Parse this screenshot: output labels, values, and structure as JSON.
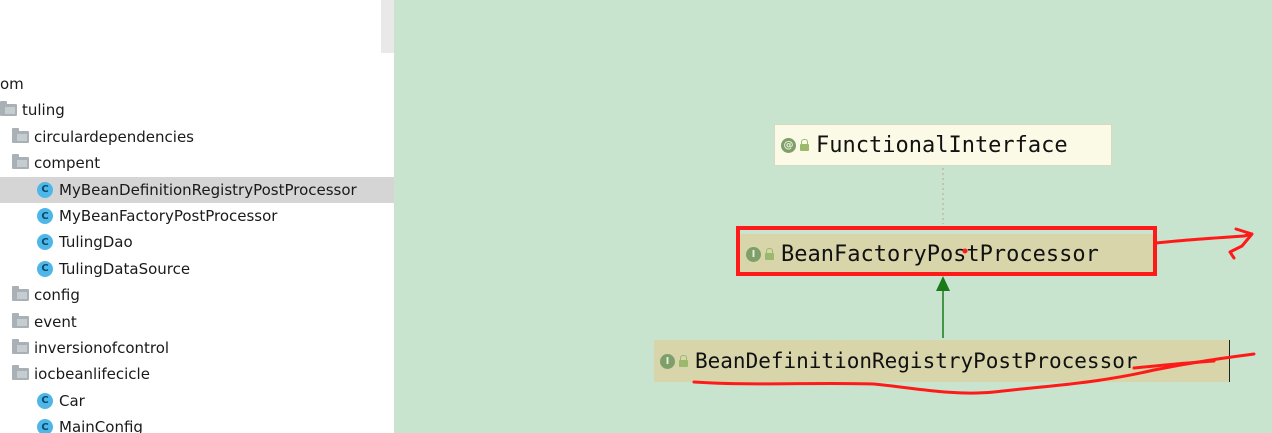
{
  "tree": {
    "rows": [
      {
        "label": "om",
        "kind": "text",
        "indent": 0
      },
      {
        "label": "tuling",
        "kind": "folder",
        "indent": 1
      },
      {
        "label": "circulardependencies",
        "kind": "folder",
        "indent": 2
      },
      {
        "label": "compent",
        "kind": "folder",
        "indent": 2
      },
      {
        "label": "MyBeanDefinitionRegistryPostProcessor",
        "kind": "class",
        "indent": 3,
        "selected": true
      },
      {
        "label": "MyBeanFactoryPostProcessor",
        "kind": "class",
        "indent": 3
      },
      {
        "label": "TulingDao",
        "kind": "class",
        "indent": 3
      },
      {
        "label": "TulingDataSource",
        "kind": "class",
        "indent": 3
      },
      {
        "label": "config",
        "kind": "folder",
        "indent": 2
      },
      {
        "label": "event",
        "kind": "folder",
        "indent": 2
      },
      {
        "label": "inversionofcontrol",
        "kind": "folder",
        "indent": 2
      },
      {
        "label": "iocbeanlifecicle",
        "kind": "folder",
        "indent": 2
      },
      {
        "label": "Car",
        "kind": "class",
        "indent": 3
      },
      {
        "label": "MainConfig",
        "kind": "class",
        "indent": 3
      }
    ],
    "class_icon_letter": "C"
  },
  "diagram": {
    "annotation_node": {
      "badge": "@",
      "label": "FunctionalInterface"
    },
    "parent_node": {
      "badge": "I",
      "label": "BeanFactoryPostProcessor"
    },
    "child_node": {
      "badge": "I",
      "label": "BeanDefinitionRegistryPostProcessor"
    },
    "colors": {
      "canvas": "#c8e4cf",
      "node_fill": "#d7d5a9",
      "annotation_fill": "#fafae6",
      "arrow": "#1a7a1a",
      "markup": "#ff1a1a"
    }
  }
}
